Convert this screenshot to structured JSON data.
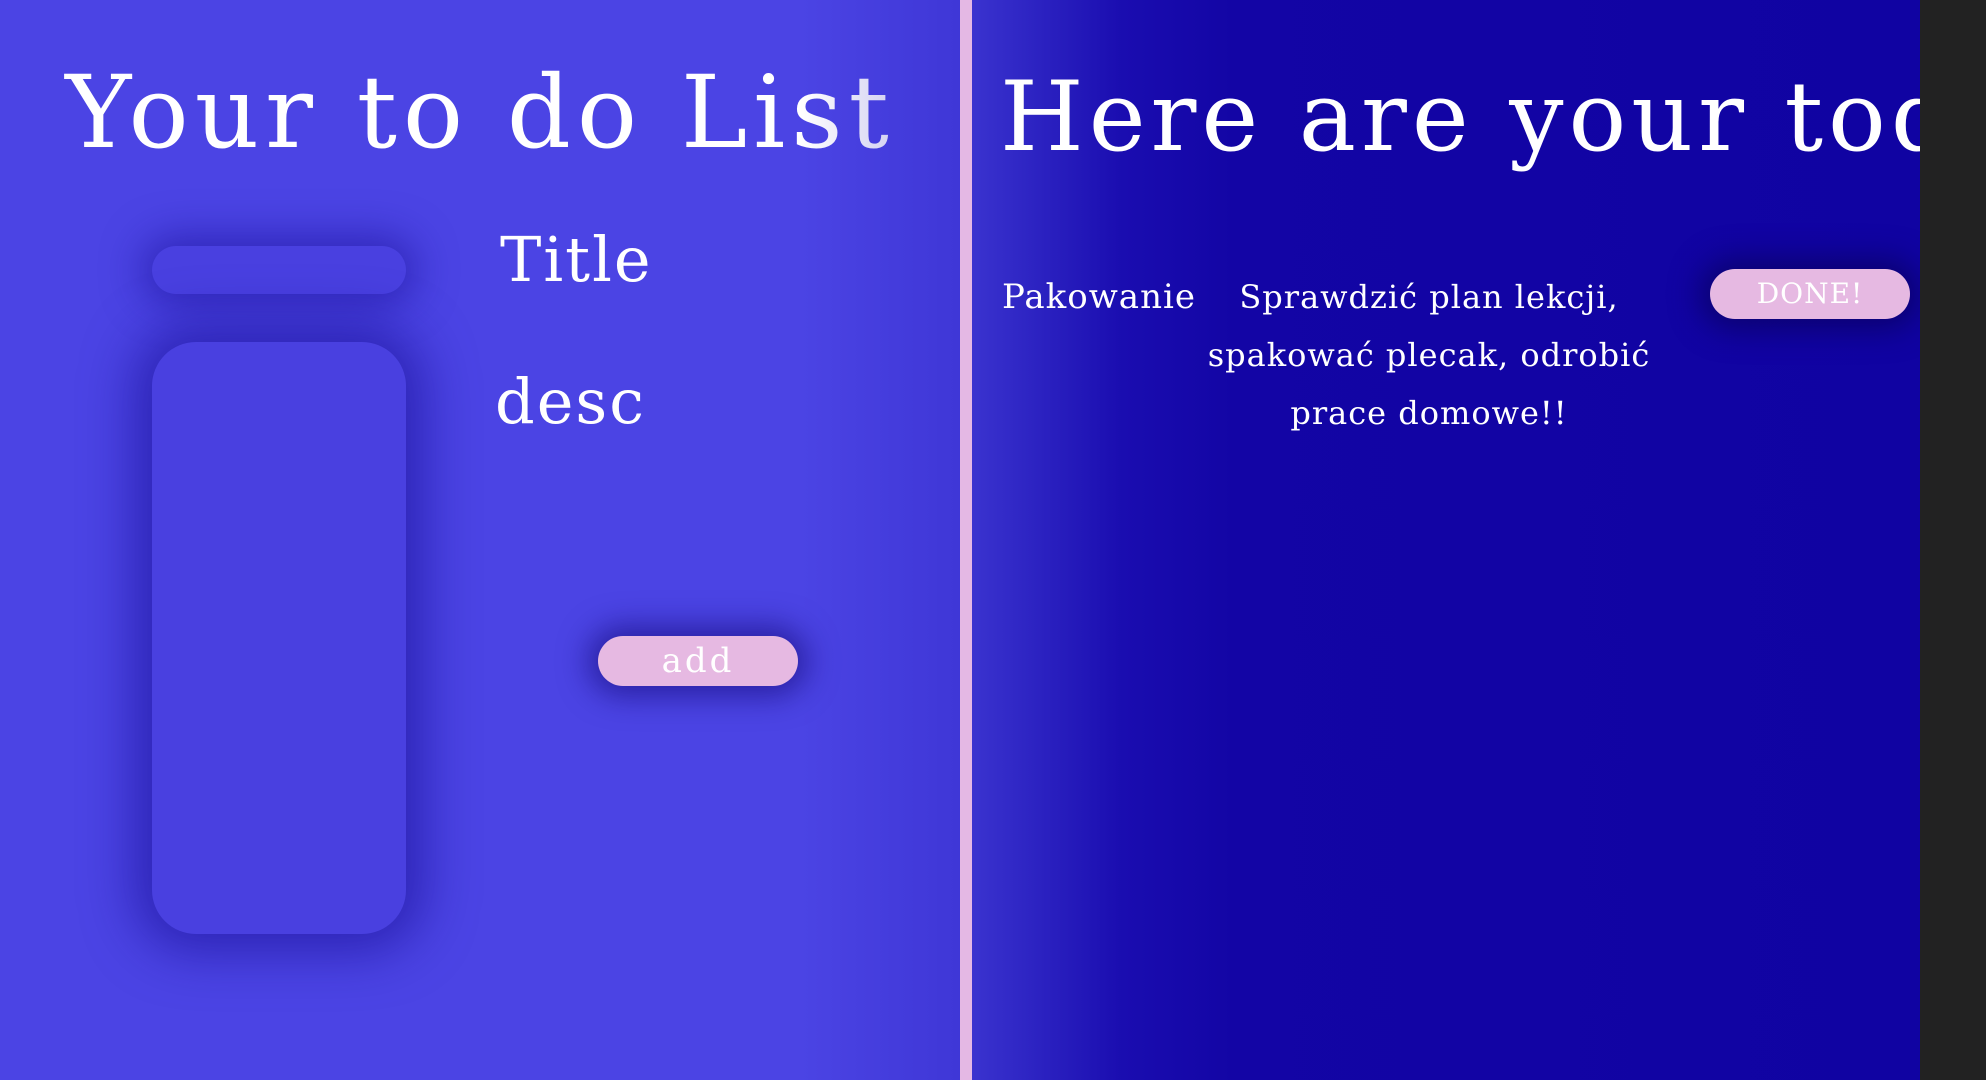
{
  "left": {
    "title": "Your to do List",
    "title_field_label": "Title",
    "desc_field_label": "desc",
    "title_input_value": "",
    "desc_input_value": "",
    "add_label": "add"
  },
  "right": {
    "title": "Here are your todo's",
    "todos": [
      {
        "title": "Pakowanie",
        "description": "Sprawdzić plan lekcji, spakować plecak, odrobić prace domowe!!",
        "done_label": "DONE!"
      }
    ]
  },
  "colors": {
    "left_bg": "#4b44e4",
    "right_bg": "#1003a2",
    "divider": "#e4b8e4",
    "button_bg": "#e6b9e2",
    "text": "#ffffff"
  }
}
